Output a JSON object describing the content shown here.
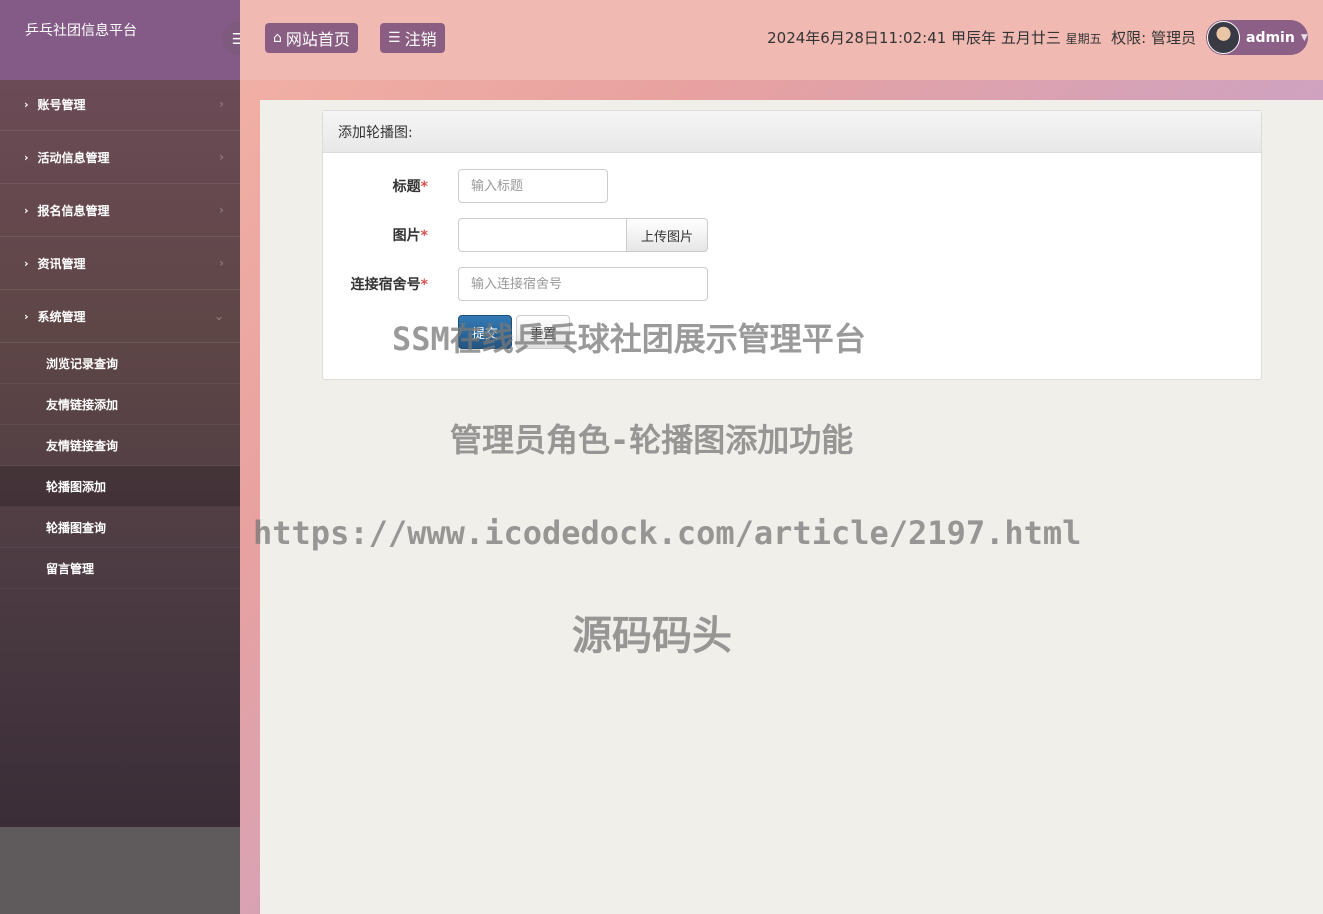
{
  "brand": {
    "title": "乒乓社团信息平台"
  },
  "header": {
    "home_label": "网站首页",
    "logout_label": "注销",
    "datetime": "2024年6月28日11:02:41 甲辰年 五月廿三",
    "weekday": "星期五",
    "role_label": "权限: 管理员",
    "username": "admin"
  },
  "sidebar": {
    "items": [
      {
        "label": "账号管理"
      },
      {
        "label": "活动信息管理"
      },
      {
        "label": "报名信息管理"
      },
      {
        "label": "资讯管理"
      },
      {
        "label": "系统管理"
      }
    ],
    "subitems": [
      {
        "label": "浏览记录查询"
      },
      {
        "label": "友情链接添加"
      },
      {
        "label": "友情链接查询"
      },
      {
        "label": "轮播图添加"
      },
      {
        "label": "轮播图查询"
      },
      {
        "label": "留言管理"
      }
    ]
  },
  "form": {
    "heading": "添加轮播图:",
    "title_label": "标题",
    "title_placeholder": "输入标题",
    "image_label": "图片",
    "upload_label": "上传图片",
    "link_label": "连接宿舍号",
    "link_placeholder": "输入连接宿舍号",
    "required_mark": "*",
    "submit_label": "提交",
    "reset_label": "重置"
  },
  "watermark": {
    "line1": "SSM在线乒乓球社团展示管理平台",
    "line2": "管理员角色-轮播图添加功能",
    "line3": "https://www.icodedock.com/article/2197.html",
    "line4": "源码码头"
  },
  "colors": {
    "header_bg": "#f0bab3",
    "button_bg": "#8a5d82",
    "submit_bg": "#337ab7",
    "required": "#d9534f"
  }
}
